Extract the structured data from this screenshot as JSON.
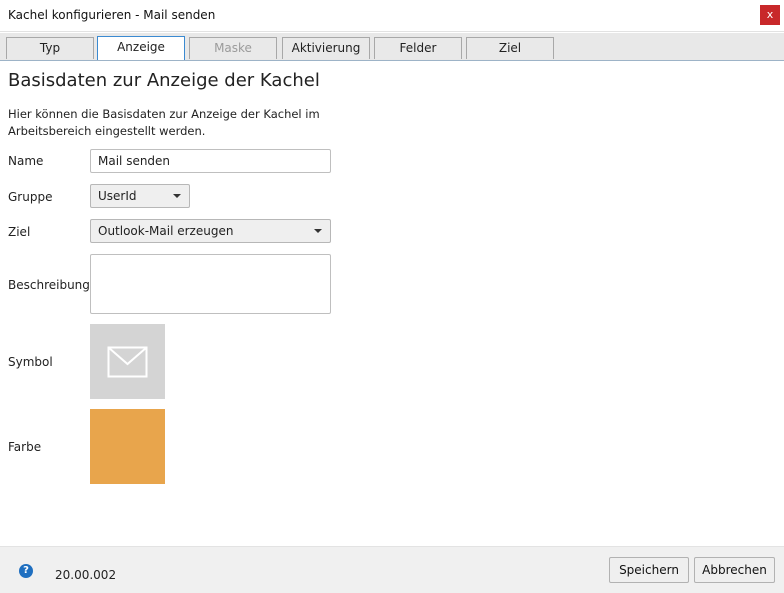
{
  "window": {
    "title": "Kachel konfigurieren - Mail senden",
    "close_label": "x"
  },
  "tabs": [
    {
      "label": "Typ",
      "state": "normal"
    },
    {
      "label": "Anzeige",
      "state": "active"
    },
    {
      "label": "Maske",
      "state": "disabled"
    },
    {
      "label": "Aktivierung",
      "state": "normal"
    },
    {
      "label": "Felder",
      "state": "normal"
    },
    {
      "label": "Ziel",
      "state": "normal"
    }
  ],
  "section": {
    "heading": "Basisdaten zur Anzeige der Kachel",
    "description_line1": "Hier können die Basisdaten zur Anzeige der Kachel im",
    "description_line2": "Arbeitsbereich eingestellt werden."
  },
  "form": {
    "name_label": "Name",
    "name_value": "Mail senden",
    "gruppe_label": "Gruppe",
    "gruppe_value": "UserId",
    "ziel_label": "Ziel",
    "ziel_value": "Outlook-Mail erzeugen",
    "beschreibung_label": "Beschreibung",
    "beschreibung_value": "",
    "symbol_label": "Symbol",
    "symbol_icon": "envelope-icon",
    "farbe_label": "Farbe",
    "farbe_color": "#E8A54C"
  },
  "footer": {
    "help_icon_glyph": "?",
    "version": "20.00.002",
    "save_label": "Speichern",
    "cancel_label": "Abbrechen"
  },
  "colors": {
    "close_button": "#C8282A",
    "active_tab_border": "#3B8AD1",
    "symbol_tile": "#D4D4D4",
    "help_icon": "#1F6FC0"
  }
}
